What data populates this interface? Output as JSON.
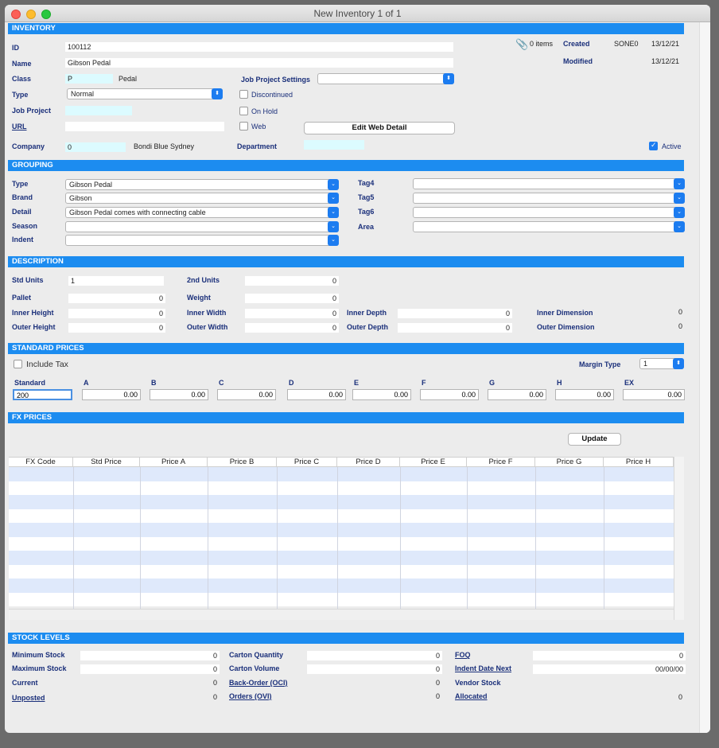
{
  "window": {
    "title": "New Inventory  1  of  1"
  },
  "inventory": {
    "header": "INVENTORY",
    "id_label": "ID",
    "id_value": "100112",
    "name_label": "Name",
    "name_value": "Gibson Pedal",
    "class_label": "Class",
    "class_code": "P",
    "class_name": "Pedal",
    "type_label": "Type",
    "type_value": "Normal",
    "job_project_label": "Job Project",
    "url_label": "URL",
    "company_label": "Company",
    "company_code": "0",
    "company_name": "Bondi Blue Sydney",
    "job_project_settings_label": "Job Project Settings",
    "discontinued_label": "Discontinued",
    "on_hold_label": "On Hold",
    "web_label": "Web",
    "edit_web_detail": "Edit Web Detail",
    "department_label": "Department",
    "items_count": "0 items",
    "created_label": "Created",
    "created_by": "SONE0",
    "created_date": "13/12/21",
    "modified_label": "Modified",
    "modified_date": "13/12/21",
    "active_label": "Active"
  },
  "grouping": {
    "header": "GROUPING",
    "type_label": "Type",
    "type_value": "Gibson Pedal",
    "brand_label": "Brand",
    "brand_value": "Gibson",
    "detail_label": "Detail",
    "detail_value": "Gibson Pedal comes with connecting cable",
    "season_label": "Season",
    "indent_label": "Indent",
    "tag4_label": "Tag4",
    "tag5_label": "Tag5",
    "tag6_label": "Tag6",
    "area_label": "Area"
  },
  "description": {
    "header": "DESCRIPTION",
    "std_units_label": "Std Units",
    "std_units_value": "1",
    "second_units_label": "2nd Units",
    "second_units_value": "0",
    "pallet_label": "Pallet",
    "pallet_value": "0",
    "weight_label": "Weight",
    "weight_value": "0",
    "inner_height_label": "Inner Height",
    "inner_height_value": "0",
    "inner_width_label": "Inner Width",
    "inner_width_value": "0",
    "inner_depth_label": "Inner Depth",
    "inner_depth_value": "0",
    "inner_dimension_label": "Inner Dimension",
    "inner_dimension_value": "0",
    "outer_height_label": "Outer Height",
    "outer_height_value": "0",
    "outer_width_label": "Outer Width",
    "outer_width_value": "0",
    "outer_depth_label": "Outer Depth",
    "outer_depth_value": "0",
    "outer_dimension_label": "Outer Dimension",
    "outer_dimension_value": "0"
  },
  "standard_prices": {
    "header": "STANDARD PRICES",
    "include_tax_label": "Include Tax",
    "margin_type_label": "Margin Type",
    "margin_type_value": "1",
    "labels": [
      "Standard",
      "A",
      "B",
      "C",
      "D",
      "E",
      "F",
      "G",
      "H",
      "EX"
    ],
    "values": [
      "200",
      "0.00",
      "0.00",
      "0.00",
      "0.00",
      "0.00",
      "0.00",
      "0.00",
      "0.00",
      "0.00"
    ]
  },
  "fx_prices": {
    "header": "FX PRICES",
    "update_label": "Update",
    "columns": [
      "FX Code",
      "Std Price",
      "Price A",
      "Price B",
      "Price C",
      "Price D",
      "Price E",
      "Price F",
      "Price G",
      "Price H"
    ],
    "stripe_color": "#dfe9fb"
  },
  "stock_levels": {
    "header": "STOCK LEVELS",
    "minimum_stock_label": "Minimum Stock",
    "minimum_stock_value": "0",
    "maximum_stock_label": "Maximum Stock",
    "maximum_stock_value": "0",
    "current_label": "Current",
    "current_value": "0",
    "unposted_label": "Unposted",
    "unposted_value": "0",
    "carton_quantity_label": "Carton Quantity",
    "carton_quantity_value": "0",
    "carton_volume_label": "Carton Volume",
    "carton_volume_value": "0",
    "back_order_label": "Back-Order (OCI)",
    "back_order_value": "0",
    "orders_label": "Orders (OVI)",
    "orders_value": "0",
    "foq_label": "FOQ",
    "foq_value": "0",
    "indent_date_next_label": "Indent Date Next",
    "indent_date_next_value": "00/00/00",
    "vendor_stock_label": "Vendor Stock",
    "allocated_label": "Allocated",
    "allocated_value": "0"
  },
  "colors": {
    "accent": "#1c8cf0",
    "label": "#1a2f7a",
    "cyan_field": "#dcfbff"
  }
}
